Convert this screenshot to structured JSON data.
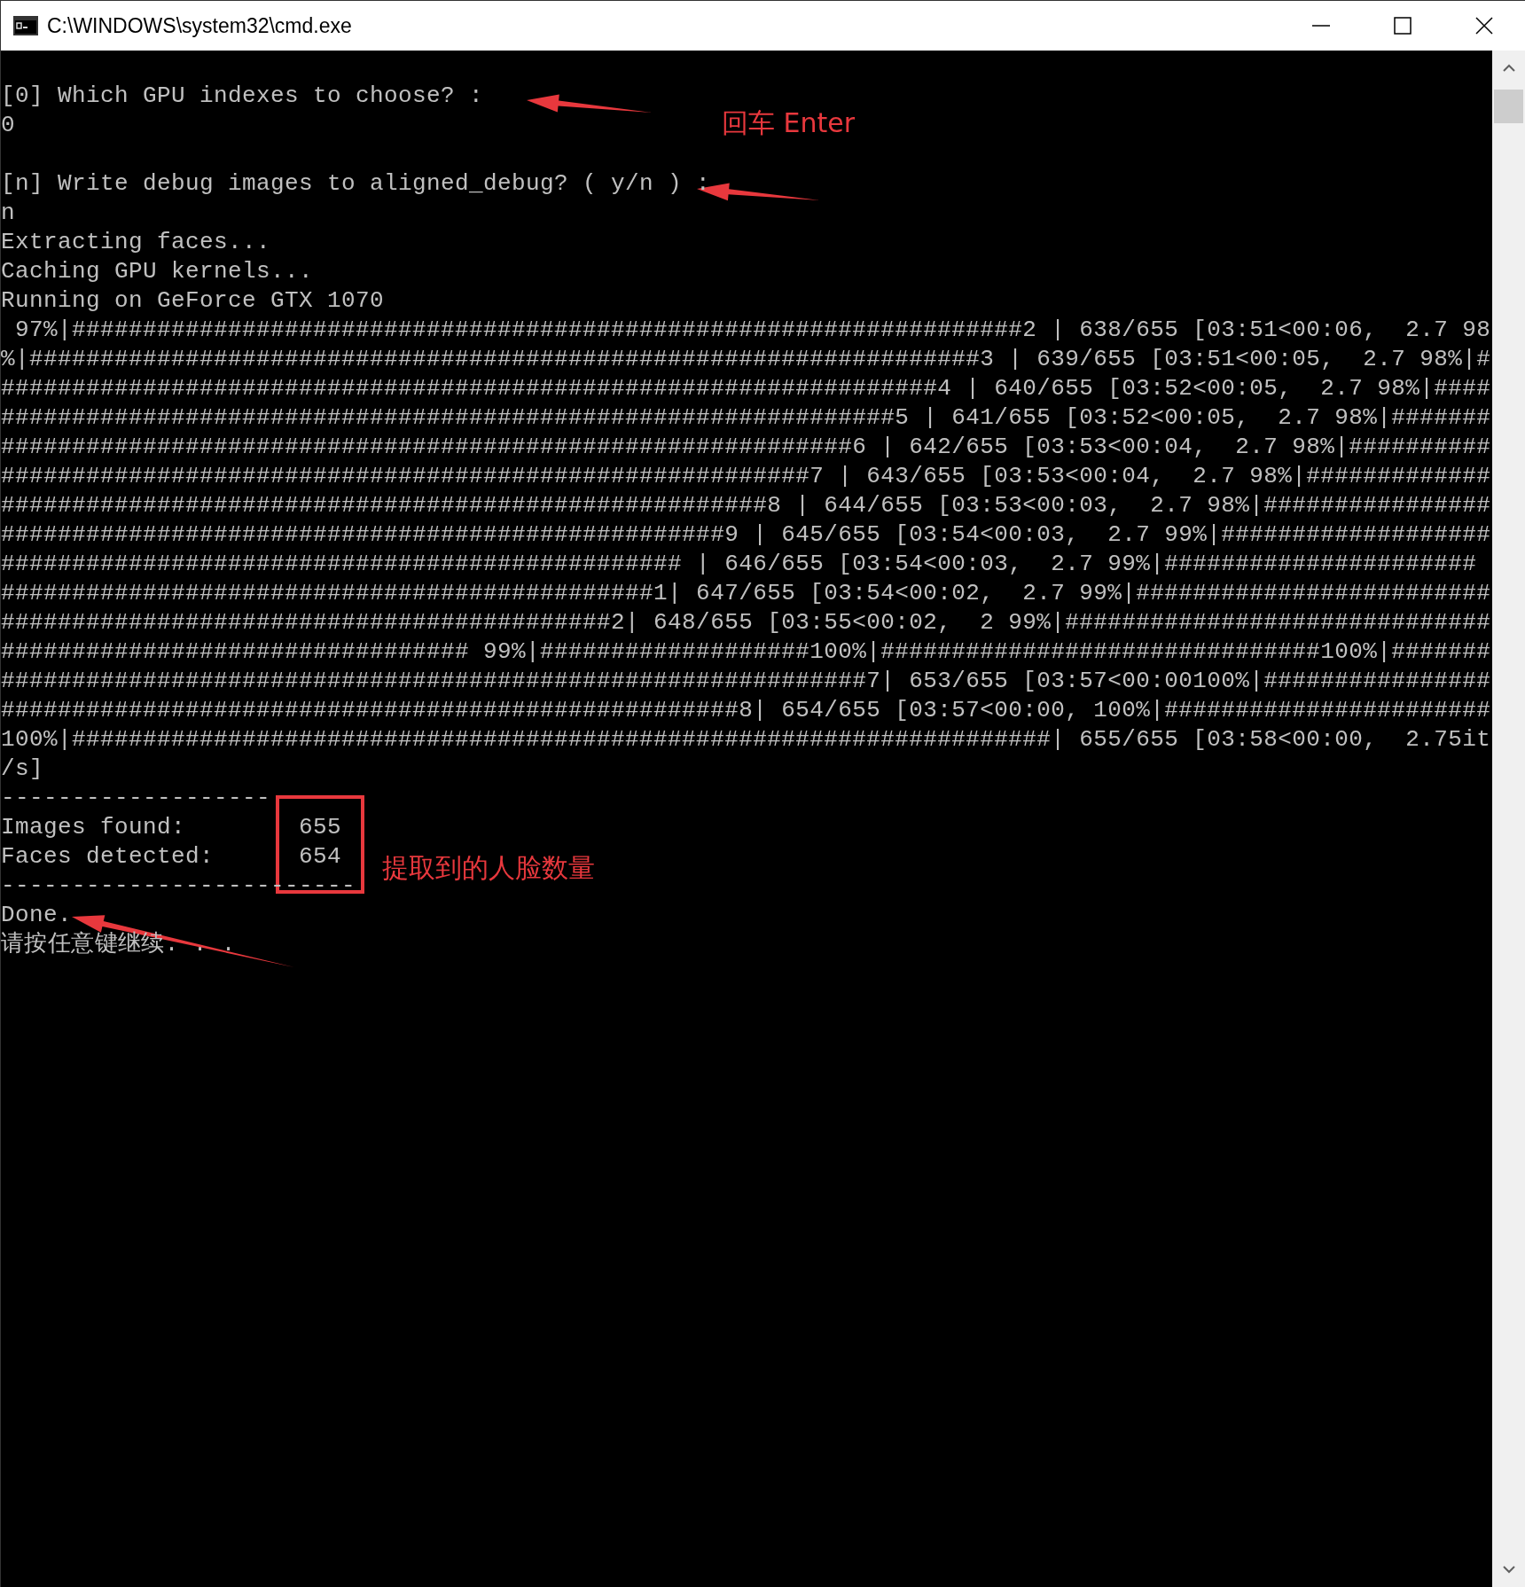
{
  "window": {
    "title": "C:\\WINDOWS\\system32\\cmd.exe"
  },
  "console": {
    "blocks": [
      [
        "[0] Which GPU indexes to choose? :",
        "0"
      ],
      [
        "[n] Write debug images to aligned_debug? ( y/n ) :",
        "n",
        "Extracting faces...",
        "Caching GPU kernels...",
        "Running on GeForce GTX 1070",
        " 97%|###################################################################2 | 638/655 [03:51<00:06,  2.7 98",
        "%|###################################################################3 | 639/655 [03:51<00:05,  2.7 98%|#",
        "##################################################################4 | 640/655 [03:52<00:05,  2.7 98%|####",
        "###############################################################5 | 641/655 [03:52<00:05,  2.7 98%|#######",
        "############################################################6 | 642/655 [03:53<00:04,  2.7 98%|##########",
        "#########################################################7 | 643/655 [03:53<00:04,  2.7 98%|#############",
        "######################################################8 | 644/655 [03:53<00:03,  2.7 98%|################",
        "###################################################9 | 645/655 [03:54<00:03,  2.7 99%|###################",
        "################################################ | 646/655 [03:54<00:03,  2.7 99%|######################",
        "##############################################1| 647/655 [03:54<00:02,  2.7 99%|#########################",
        "###########################################2| 648/655 [03:55<00:02,  2 99%|##############################",
        "################################# 99%|###################100%|###############################100%|#######",
        "#############################################################7| 653/655 [03:57<00:00100%|################",
        "####################################################8| 654/655 [03:57<00:00, 100%|#######################",
        "100%|#####################################################################| 655/655 [03:58<00:00,  2.75it",
        "/s]",
        "-------------------",
        "Images found:        655",
        "Faces detected:      654",
        "-------------------------",
        "Done.",
        "请按任意键继续. . ."
      ]
    ]
  },
  "annotations": {
    "labels": [
      "回车 Enter",
      "提取到的人脸数量"
    ]
  }
}
